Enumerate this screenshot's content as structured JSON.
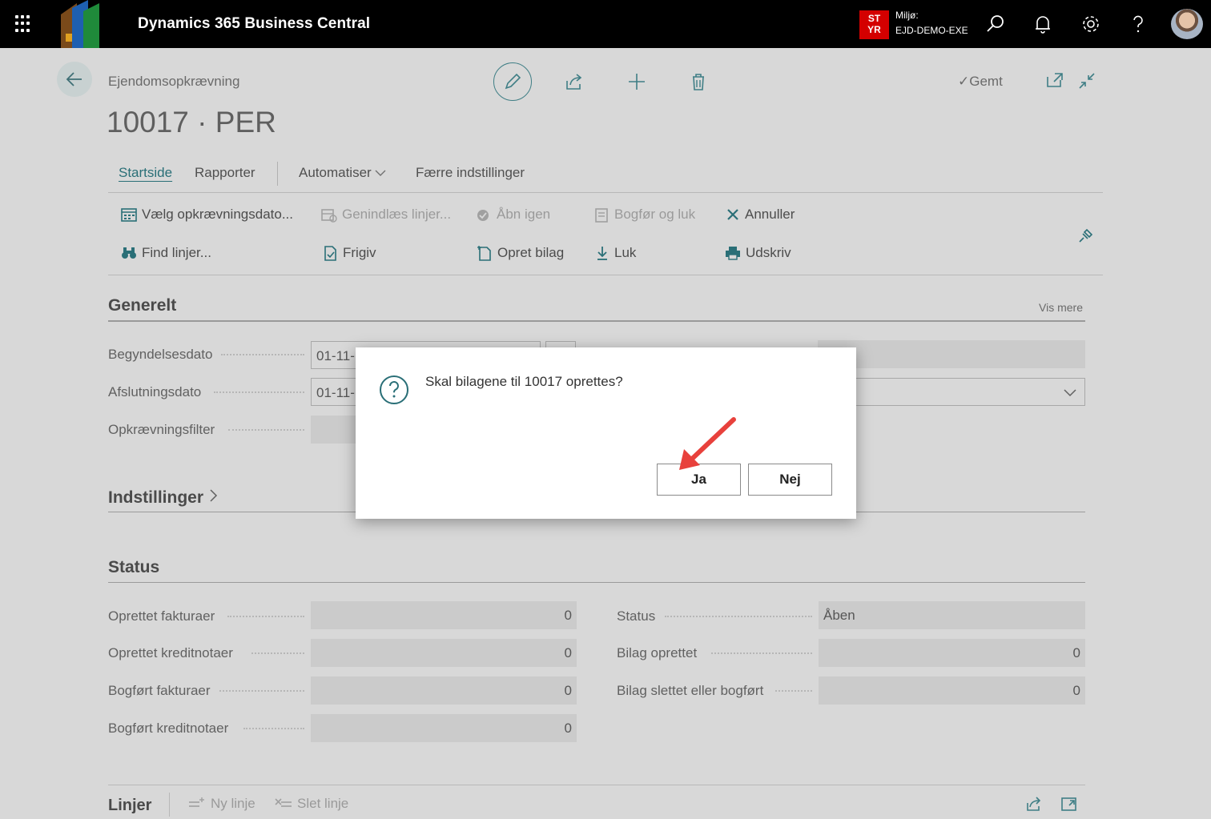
{
  "topbar": {
    "app_title": "Dynamics 365 Business Central",
    "env_badge_line1": "ST",
    "env_badge_line2": "YR",
    "env_label": "Miljø:",
    "env_name": "EJD-DEMO-EXE"
  },
  "page": {
    "breadcrumb": "Ejendomsopkrævning",
    "title": "10017 · PER",
    "saved_label": "Gemt"
  },
  "tabs": [
    {
      "label": "Startside",
      "active": true
    },
    {
      "label": "Rapporter"
    },
    {
      "label": "Automatiser"
    },
    {
      "label": "Færre indstillinger"
    }
  ],
  "actions": {
    "row1": [
      {
        "label": "Vælg opkrævningsdato...",
        "icon": "calendar-icon",
        "enabled": true
      },
      {
        "label": "Genindlæs linjer...",
        "icon": "reload-lines-icon",
        "enabled": false
      },
      {
        "label": "Åbn igen",
        "icon": "reopen-icon",
        "enabled": false
      },
      {
        "label": "Bogfør og luk",
        "icon": "post-close-icon",
        "enabled": false
      },
      {
        "label": "Annuller",
        "icon": "cancel-x-icon",
        "enabled": true
      }
    ],
    "row2": [
      {
        "label": "Find linjer...",
        "icon": "binoculars-icon",
        "enabled": true
      },
      {
        "label": "Frigiv",
        "icon": "release-icon",
        "enabled": true
      },
      {
        "label": "Opret bilag",
        "icon": "create-document-icon",
        "enabled": true
      },
      {
        "label": "Luk",
        "icon": "download-icon",
        "enabled": true
      },
      {
        "label": "Udskriv",
        "icon": "printer-icon",
        "enabled": true
      }
    ]
  },
  "general": {
    "title": "Generelt",
    "show_more": "Vis mere",
    "fields": [
      {
        "label": "Begyndelsesdato",
        "value": "01-11-"
      },
      {
        "label": "Afslutningsdato",
        "value": "01-11-"
      },
      {
        "label": "Opkrævningsfilter",
        "value": ""
      }
    ]
  },
  "settings": {
    "title": "Indstillinger"
  },
  "status": {
    "title": "Status",
    "left_fields": [
      {
        "label": "Oprettet fakturaer",
        "value": "0"
      },
      {
        "label": "Oprettet kreditnotaer",
        "value": "0"
      },
      {
        "label": "Bogført fakturaer",
        "value": "0"
      },
      {
        "label": "Bogført kreditnotaer",
        "value": "0"
      }
    ],
    "right_fields": [
      {
        "label": "Status",
        "value": "Åben"
      },
      {
        "label": "Bilag oprettet",
        "value": "0"
      },
      {
        "label": "Bilag slettet eller bogført",
        "value": "0"
      }
    ]
  },
  "lines": {
    "title": "Linjer",
    "new_line": "Ny linje",
    "delete_line": "Slet linje"
  },
  "dialog": {
    "message": "Skal bilagene til 10017 oprettes?",
    "yes_label": "Ja",
    "no_label": "Nej"
  },
  "colors": {
    "accent": "#2a6f77",
    "env_badge": "#d40000",
    "annotation_arrow": "#e8413c"
  }
}
